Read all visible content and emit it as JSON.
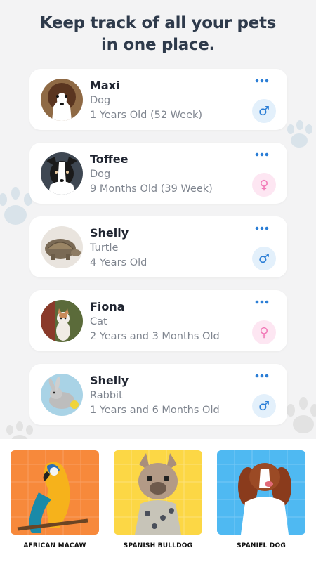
{
  "headline": {
    "line1": "Keep track of all your pets",
    "line2": "in one place."
  },
  "pets": [
    {
      "name": "Maxi",
      "type": "Dog",
      "age": "1 Years Old (52 Week)",
      "gender": "male",
      "gender_symbol": "♂"
    },
    {
      "name": "Toffee",
      "type": "Dog",
      "age": "9 Months Old (39 Week)",
      "gender": "female",
      "gender_symbol": "♀"
    },
    {
      "name": "Shelly",
      "type": "Turtle",
      "age": "4 Years Old",
      "gender": "male",
      "gender_symbol": "♂"
    },
    {
      "name": "Fiona",
      "type": "Cat",
      "age": "2 Years and 3 Months Old",
      "gender": "female",
      "gender_symbol": "♀"
    },
    {
      "name": "Shelly",
      "type": "Rabbit",
      "age": "1 Years and 6 Months Old",
      "gender": "male",
      "gender_symbol": "♂"
    }
  ],
  "breeds": [
    {
      "label": "AFRICAN MACAW",
      "bg": "#f7893b"
    },
    {
      "label": "SPANISH BULLDOG",
      "bg": "#fcd745"
    },
    {
      "label": "SPANIEL DOG",
      "bg": "#4fb9f2"
    }
  ],
  "colors": {
    "male_accent": "#2b7ed6",
    "female_accent": "#f27ab8",
    "more_dots": "#2b7ed6"
  }
}
